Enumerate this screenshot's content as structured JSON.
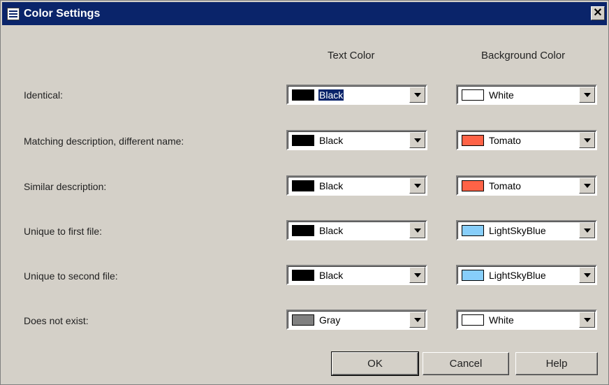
{
  "window": {
    "title": "Color Settings",
    "close_glyph": "✕"
  },
  "columns": {
    "text_color": "Text Color",
    "background_color": "Background Color"
  },
  "rows": [
    {
      "label": "Identical:",
      "text_color": {
        "value": "Black",
        "swatch": "#000000"
      },
      "bg_color": {
        "value": "White",
        "swatch": "#ffffff"
      }
    },
    {
      "label": "Matching description, different name:",
      "text_color": {
        "value": "Black",
        "swatch": "#000000"
      },
      "bg_color": {
        "value": "Tomato",
        "swatch": "#ff6347"
      }
    },
    {
      "label": "Similar description:",
      "text_color": {
        "value": "Black",
        "swatch": "#000000"
      },
      "bg_color": {
        "value": "Tomato",
        "swatch": "#ff6347"
      }
    },
    {
      "label": "Unique to first file:",
      "text_color": {
        "value": "Black",
        "swatch": "#000000"
      },
      "bg_color": {
        "value": "LightSkyBlue",
        "swatch": "#87cefa"
      }
    },
    {
      "label": "Unique to second file:",
      "text_color": {
        "value": "Black",
        "swatch": "#000000"
      },
      "bg_color": {
        "value": "LightSkyBlue",
        "swatch": "#87cefa"
      }
    },
    {
      "label": "Does not exist:",
      "text_color": {
        "value": "Gray",
        "swatch": "#808080"
      },
      "bg_color": {
        "value": "White",
        "swatch": "#ffffff"
      }
    }
  ],
  "buttons": {
    "ok": "OK",
    "cancel": "Cancel",
    "help": "Help"
  }
}
